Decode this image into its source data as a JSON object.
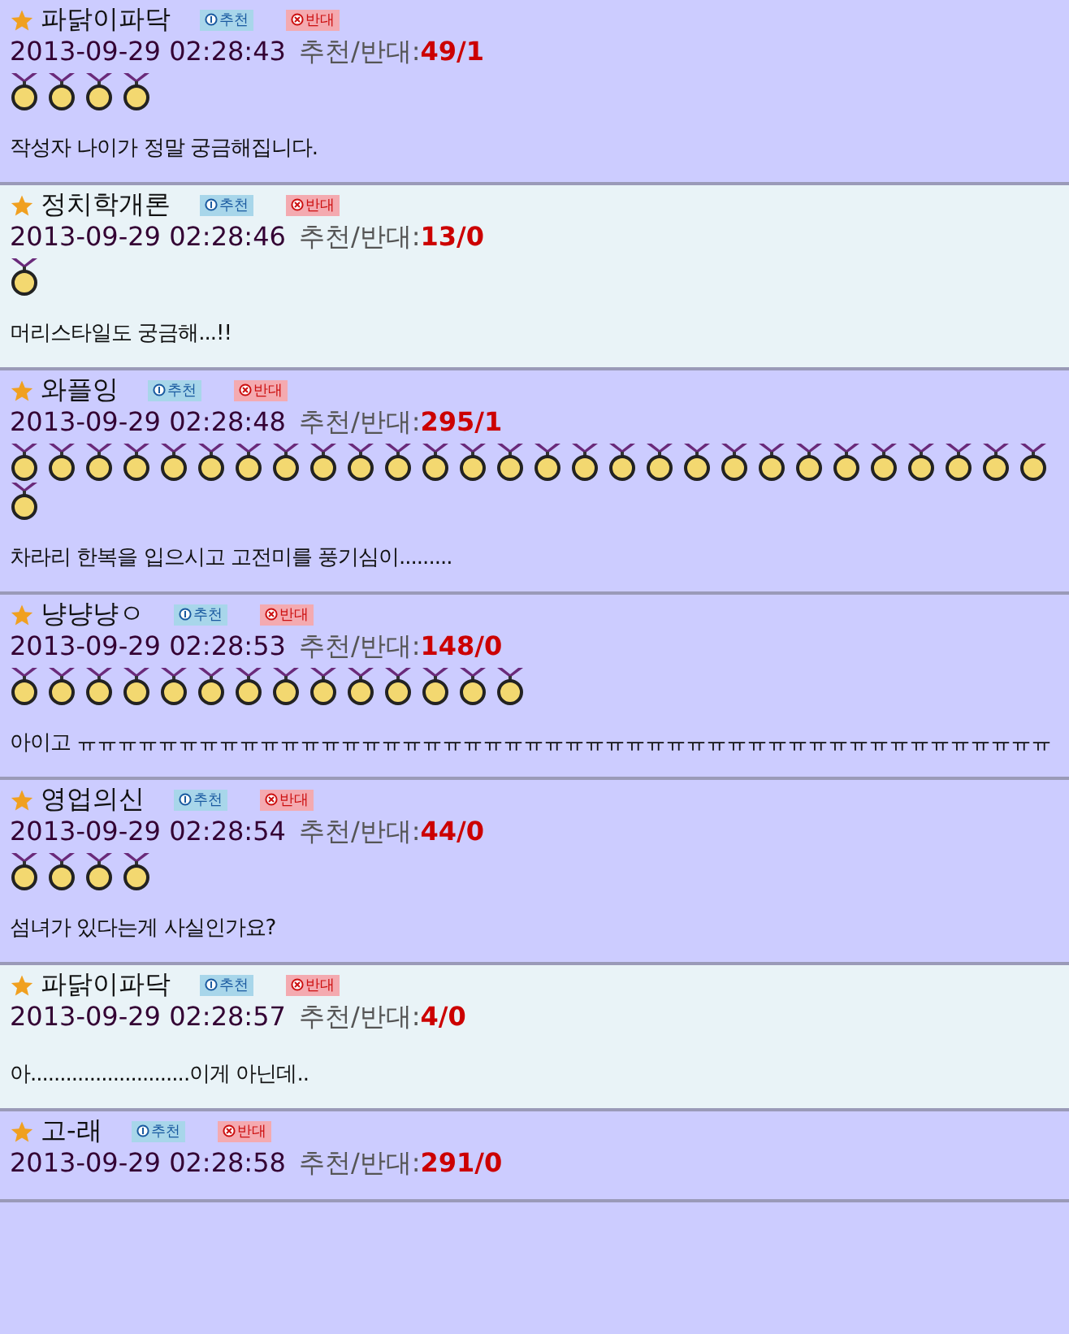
{
  "comments": [
    {
      "author": "파닭이파닥",
      "recommend": "추천",
      "oppose": "반대",
      "date": "2013-09-29 02:28:43",
      "votes_label": "추천/반대:",
      "votes": "49/1",
      "highlighted": true,
      "text": "작성자 나이가 정말 궁금해집니다.",
      "medals": [
        {
          "kind": "gold"
        },
        {
          "kind": "gold"
        },
        {
          "kind": "gold"
        },
        {
          "kind": "gold"
        }
      ]
    },
    {
      "author": "정치학개론",
      "recommend": "추천",
      "oppose": "반대",
      "date": "2013-09-29 02:28:46",
      "votes_label": "추천/반대:",
      "votes": "13/0",
      "highlighted": false,
      "text": "머리스타일도 궁금해...!!",
      "medals": [
        {
          "kind": "gold"
        }
      ]
    },
    {
      "author": "와플잉",
      "recommend": "추천",
      "oppose": "반대",
      "date": "2013-09-29 02:28:48",
      "votes_label": "추천/반대:",
      "votes": "295/1",
      "highlighted": true,
      "text": "차라리 한복을 입으시고 고전미를 풍기심이.........",
      "medals": [
        {
          "kind": "gold"
        },
        {
          "kind": "gold"
        },
        {
          "kind": "gold"
        },
        {
          "kind": "gold"
        },
        {
          "kind": "gold"
        },
        {
          "kind": "gold"
        },
        {
          "kind": "gold"
        },
        {
          "kind": "gold"
        },
        {
          "kind": "gold"
        },
        {
          "kind": "gold"
        },
        {
          "kind": "gold"
        },
        {
          "kind": "gold"
        },
        {
          "kind": "gold"
        },
        {
          "kind": "gold"
        },
        {
          "kind": "gold"
        },
        {
          "kind": "gold"
        },
        {
          "kind": "gold"
        },
        {
          "kind": "gold"
        },
        {
          "kind": "gold"
        },
        {
          "kind": "gold"
        },
        {
          "kind": "gold"
        },
        {
          "kind": "gold"
        },
        {
          "kind": "gold"
        },
        {
          "kind": "gold"
        },
        {
          "kind": "gold"
        },
        {
          "kind": "gold"
        },
        {
          "kind": "gold"
        },
        {
          "kind": "gold"
        },
        {
          "kind": "gold"
        }
      ]
    },
    {
      "author": "냥냥냥ㅇ",
      "recommend": "추천",
      "oppose": "반대",
      "date": "2013-09-29 02:28:53",
      "votes_label": "추천/반대:",
      "votes": "148/0",
      "highlighted": true,
      "text": "아이고 ㅠㅠㅠㅠㅠㅠㅠㅠㅠㅠㅠㅠㅠㅠㅠㅠㅠㅠㅠㅠㅠㅠㅠㅠㅠㅠㅠㅠㅠㅠㅠㅠㅠㅠㅠㅠㅠㅠㅠㅠㅠㅠㅠㅠㅠㅠㅠㅠ",
      "medals": [
        {
          "kind": "gold"
        },
        {
          "kind": "gold"
        },
        {
          "kind": "gold"
        },
        {
          "kind": "gold"
        },
        {
          "kind": "gold"
        },
        {
          "kind": "gold"
        },
        {
          "kind": "gold"
        },
        {
          "kind": "gold"
        },
        {
          "kind": "gold"
        },
        {
          "kind": "gold"
        },
        {
          "kind": "gold"
        },
        {
          "kind": "gold"
        },
        {
          "kind": "gold"
        },
        {
          "kind": "gold"
        }
      ]
    },
    {
      "author": "영업의신",
      "recommend": "추천",
      "oppose": "반대",
      "date": "2013-09-29 02:28:54",
      "votes_label": "추천/반대:",
      "votes": "44/0",
      "highlighted": true,
      "text": "섬녀가 있다는게 사실인가요?",
      "medals": [
        {
          "kind": "gold"
        },
        {
          "kind": "gold"
        },
        {
          "kind": "gold"
        },
        {
          "kind": "gold"
        }
      ]
    },
    {
      "author": "파닭이파닥",
      "recommend": "추천",
      "oppose": "반대",
      "date": "2013-09-29 02:28:57",
      "votes_label": "추천/반대:",
      "votes": "4/0",
      "highlighted": false,
      "text": "아...........................이게 아닌데.."
    },
    {
      "author": "고-래",
      "recommend": "추천",
      "oppose": "반대",
      "date": "2013-09-29 02:28:58",
      "votes_label": "추천/반대:",
      "votes": "291/0",
      "highlighted": true
    }
  ]
}
